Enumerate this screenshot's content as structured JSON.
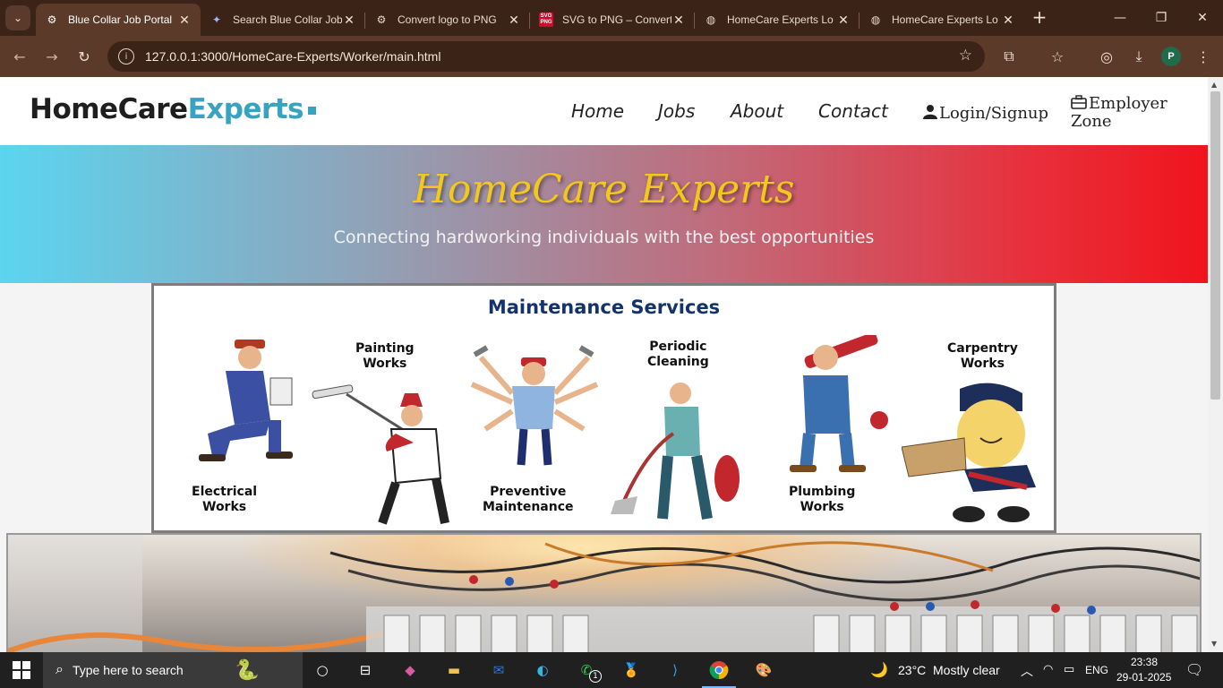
{
  "browser": {
    "tabs": [
      {
        "title": "Blue Collar Job Portal",
        "favicon": "chatgpt-icon",
        "active": true
      },
      {
        "title": "Search Blue Collar Job",
        "favicon": "gemini-icon",
        "active": false
      },
      {
        "title": "Convert logo to PNG",
        "favicon": "chatgpt-icon",
        "active": false
      },
      {
        "title": "SVG to PNG – Convert",
        "favicon": "svg-png-icon",
        "active": false
      },
      {
        "title": "HomeCare Experts Lo",
        "favicon": "globe-icon",
        "active": false
      },
      {
        "title": "HomeCare Experts Lo",
        "favicon": "globe-icon",
        "active": false
      }
    ],
    "url": "127.0.0.1:3000/HomeCare-Experts/Worker/main.html",
    "profile_initial": "P",
    "svg_favicon_text": "SVG PNG"
  },
  "site": {
    "logo_part1": "HomeCare",
    "logo_part2": "Experts",
    "nav": {
      "home": "Home",
      "jobs": "Jobs",
      "about": "About",
      "contact": "Contact",
      "login": "Login/Signup",
      "employer_line1": "Employer",
      "employer_line2": "Zone"
    },
    "hero": {
      "title": "HomeCare Experts",
      "subtitle": "Connecting hardworking individuals with the best opportunities"
    },
    "banner": {
      "title": "Maintenance Services",
      "services": [
        {
          "line1": "Electrical",
          "line2": "Works"
        },
        {
          "line1": "Painting",
          "line2": "Works"
        },
        {
          "line1": "Preventive",
          "line2": "Maintenance"
        },
        {
          "line1": "Periodic",
          "line2": "Cleaning"
        },
        {
          "line1": "Plumbing",
          "line2": "Works"
        },
        {
          "line1": "Carpentry",
          "line2": "Works"
        }
      ]
    }
  },
  "taskbar": {
    "search_placeholder": "Type here to search",
    "whatsapp_badge": "1",
    "weather_temp": "23°C",
    "weather_text": "Mostly clear",
    "language": "ENG",
    "time": "23:38",
    "date": "29-01-2025"
  },
  "colors": {
    "brand_dark": "#1e1e1e",
    "brand_accent": "#38a3c0",
    "hero_title": "#f2c81c",
    "banner_title": "#14336b"
  }
}
